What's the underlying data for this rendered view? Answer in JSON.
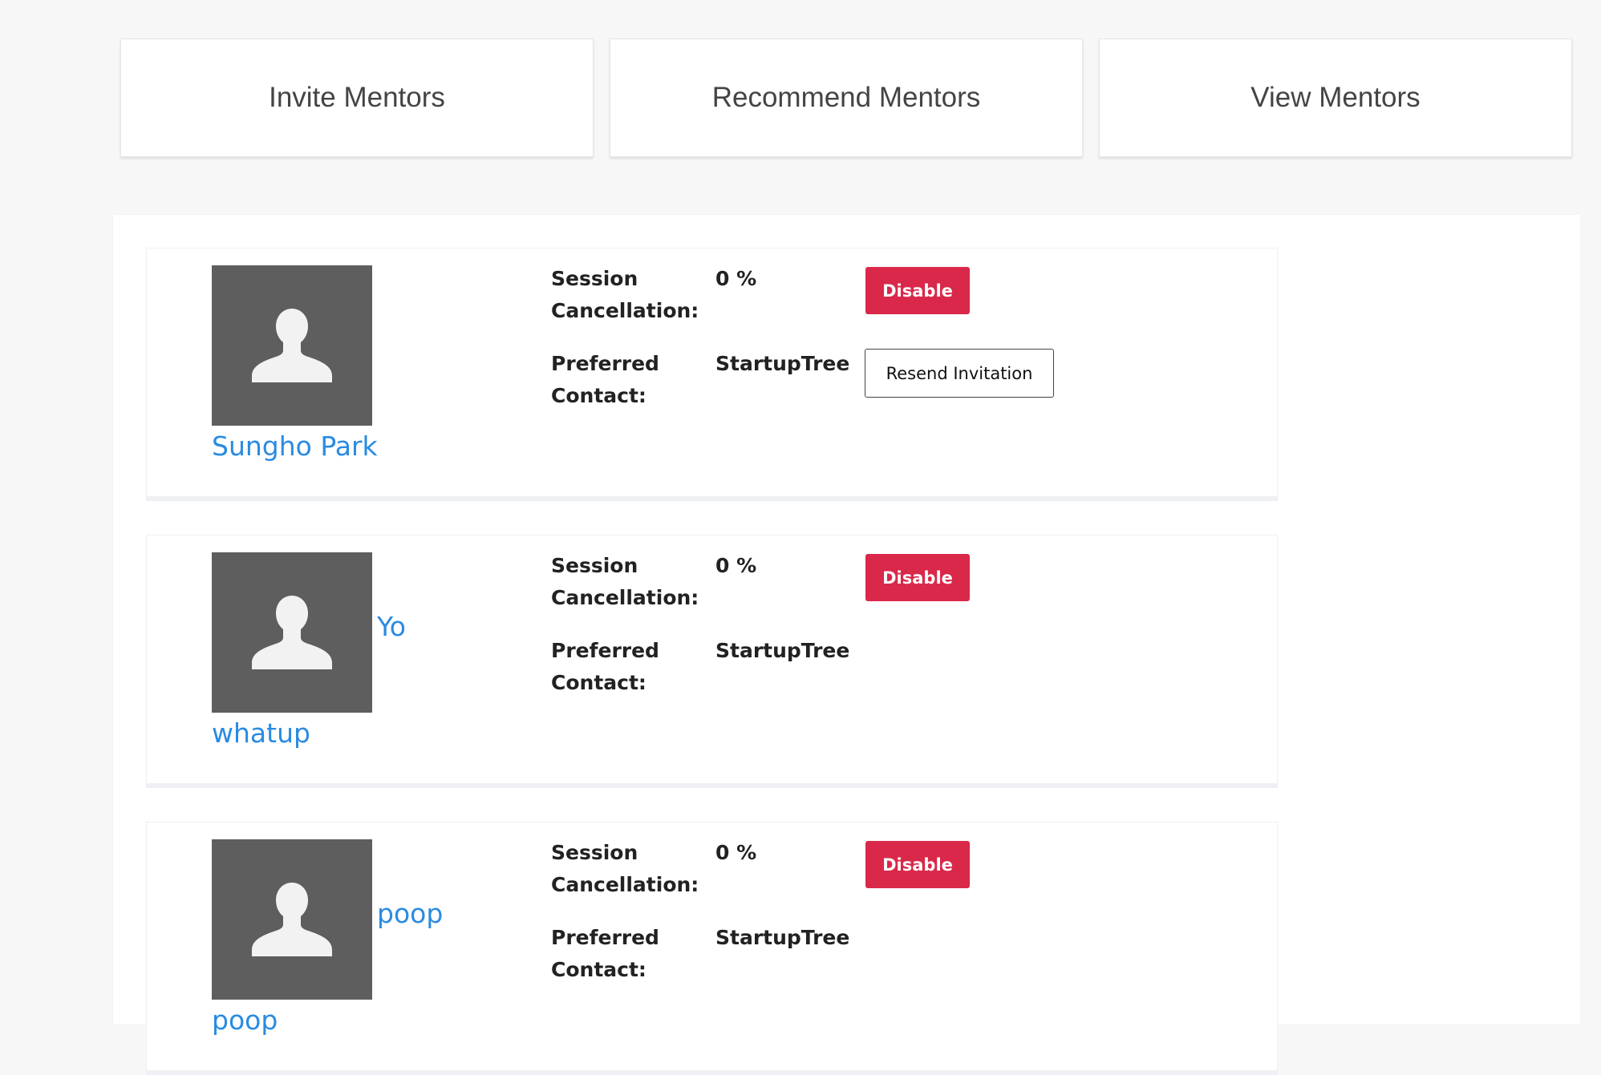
{
  "nav_tabs": [
    {
      "label": "Invite Mentors"
    },
    {
      "label": "Recommend Mentors"
    },
    {
      "label": "View Mentors"
    }
  ],
  "labels": {
    "session_cancellation": "Session Cancellation:",
    "preferred_contact": "Preferred Contact:",
    "disable_button": "Disable",
    "resend_button": "Resend Invitation"
  },
  "mentors": [
    {
      "name": "Sungho Park",
      "name_line1": "",
      "name_line2": "Sungho Park",
      "cancellation": "0 %",
      "contact": "StartupTree",
      "show_resend": true
    },
    {
      "name": "Yo whatup",
      "name_line1": "Yo",
      "name_line2": "whatup",
      "cancellation": "0 %",
      "contact": "StartupTree",
      "show_resend": false
    },
    {
      "name": "poop poop",
      "name_line1": "poop",
      "name_line2": "poop",
      "cancellation": "0 %",
      "contact": "StartupTree",
      "show_resend": false
    }
  ],
  "icons": {
    "avatar": "person-silhouette-icon"
  },
  "colors": {
    "link": "#2a8be2",
    "disable_button": "#d9284a",
    "avatar_bg": "#5e5e5e",
    "page_bg": "#f7f7f7"
  }
}
